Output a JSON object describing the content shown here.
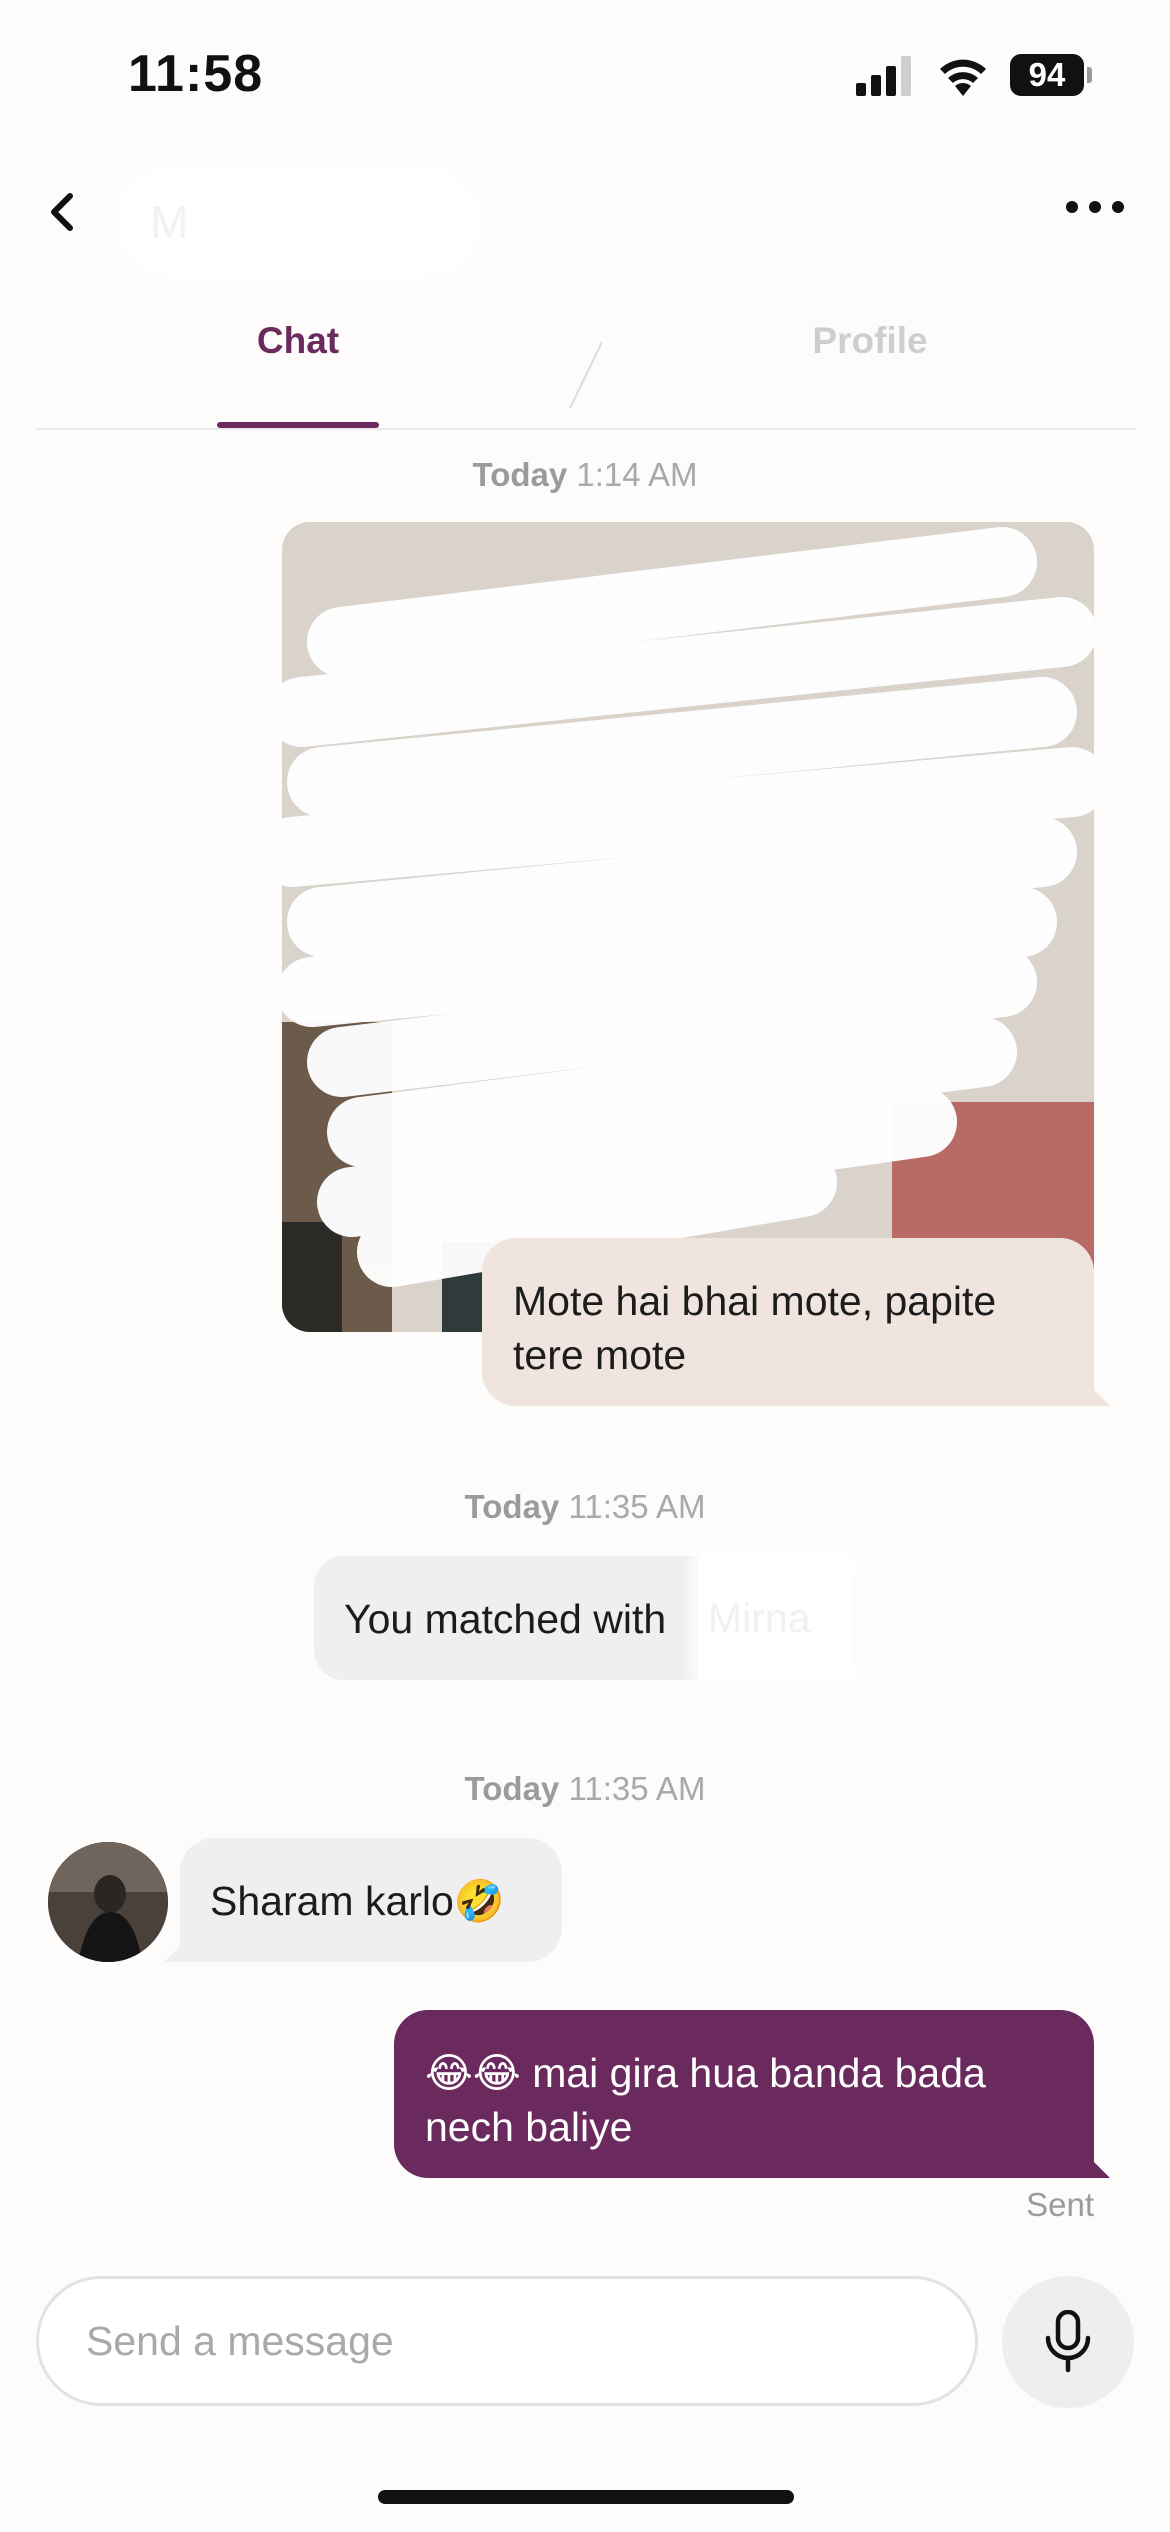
{
  "status_bar": {
    "time": "11:58",
    "battery": "94",
    "icons": [
      "signal-icon",
      "wifi-icon",
      "battery-icon"
    ]
  },
  "header": {
    "back_icon": "chevron-left-icon",
    "match_name": "M",
    "more_icon": "more-horizontal-icon"
  },
  "tabs": [
    {
      "label": "Chat",
      "active": true
    },
    {
      "label": "Profile",
      "active": false
    }
  ],
  "messages": [
    {
      "type": "timestamp",
      "day": "Today",
      "time": "1:14 AM"
    },
    {
      "type": "photo",
      "sender": "me",
      "caption": "Mote hai bhai mote, papite tere mote"
    },
    {
      "type": "timestamp",
      "day": "Today",
      "time": "11:35 AM"
    },
    {
      "type": "system",
      "text": "You matched with",
      "name": "Mirna"
    },
    {
      "type": "timestamp",
      "day": "Today",
      "time": "11:35 AM"
    },
    {
      "type": "received",
      "text": "Sharam karlo🤣"
    },
    {
      "type": "sent",
      "text": "😂😂 mai gira hua banda bada nech baliye",
      "status": "Sent"
    }
  ],
  "composer": {
    "placeholder": "Send a message",
    "mic_icon": "microphone-icon"
  },
  "colors": {
    "brand": "#6a2a5e",
    "sent_bubble": "#6a2a5e",
    "caption_bubble": "#efe4de",
    "received_bubble": "#efefef",
    "background": "#fdfcfb"
  }
}
